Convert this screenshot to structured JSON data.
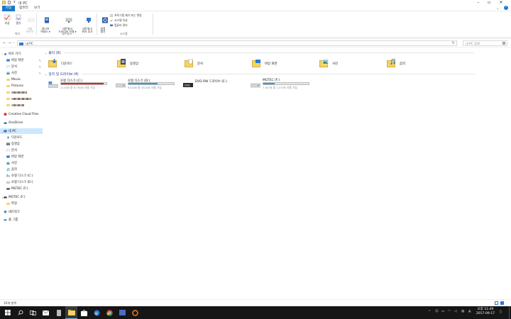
{
  "window": {
    "title": "내 PC"
  },
  "menu": {
    "tabs": [
      "파일",
      "컴퓨터",
      "보기"
    ]
  },
  "ribbon": {
    "properties": "속성",
    "open": "열기",
    "rename": "이름\n바꾸기",
    "access_media": "미디어\n액세스 ▾",
    "map_network": "네트워크\n드라이브 연결 ▾",
    "add_network_location": "네트워크\n위치 추가",
    "open_settings": "설정\n열기",
    "uninstall": "프로그램 제거 또는 변경",
    "system_properties": "시스템 속성",
    "computer_management": "컴퓨터 관리",
    "group_location": "위치",
    "group_network": "네트워크",
    "group_system": "시스템"
  },
  "address": {
    "crumb": "내 PC",
    "search_placeholder": "내 PC 검색"
  },
  "nav": {
    "quick_access": "바로 가기",
    "items": [
      "바탕 화면",
      "문서",
      "사진",
      "Movie",
      "Pictures"
    ],
    "creative_cloud": "Creative Cloud Files",
    "onedrive": "OneDrive",
    "this_pc": "내 PC",
    "pc_items": [
      "다운로드",
      "동영상",
      "문서",
      "바탕 화면",
      "사진",
      "음악",
      "로컬 디스크 (C:)",
      "로컬 디스크 (D:)",
      "MGTEC (F:)"
    ],
    "usb": "MGTEC (F:)",
    "usb_child": "파일",
    "network": "네트워크",
    "homegroup": "홈 그룹"
  },
  "content": {
    "folders_header": "폴더 (6)",
    "folders": [
      "다운로드",
      "동영상",
      "문서",
      "바탕 화면",
      "사진",
      "음악"
    ],
    "drives_header": "장치 및 드라이브 (4)",
    "drives": [
      {
        "name": "로컬 디스크 (C:)",
        "info": "111GB 중 6.70GB 사용 가능",
        "used": 0.94,
        "color": "#da2626"
      },
      {
        "name": "로컬 디스크 (D:)",
        "info": "931GB 중 332GB 사용 가능",
        "used": 0.64,
        "color": "#26a0da"
      },
      {
        "name": "DVD RW 드라이브 (E:)",
        "info": "",
        "used": null,
        "color": ""
      },
      {
        "name": "MGTEC (F:)",
        "info": "7.61TB 중 1.37TB 사용 가능",
        "used": 0.25,
        "color": "#26a0da"
      }
    ]
  },
  "status": {
    "items_count": "10개 항목"
  },
  "taskbar": {
    "ime": "A",
    "time": "오후 11:49",
    "date": "2017-09-17"
  }
}
